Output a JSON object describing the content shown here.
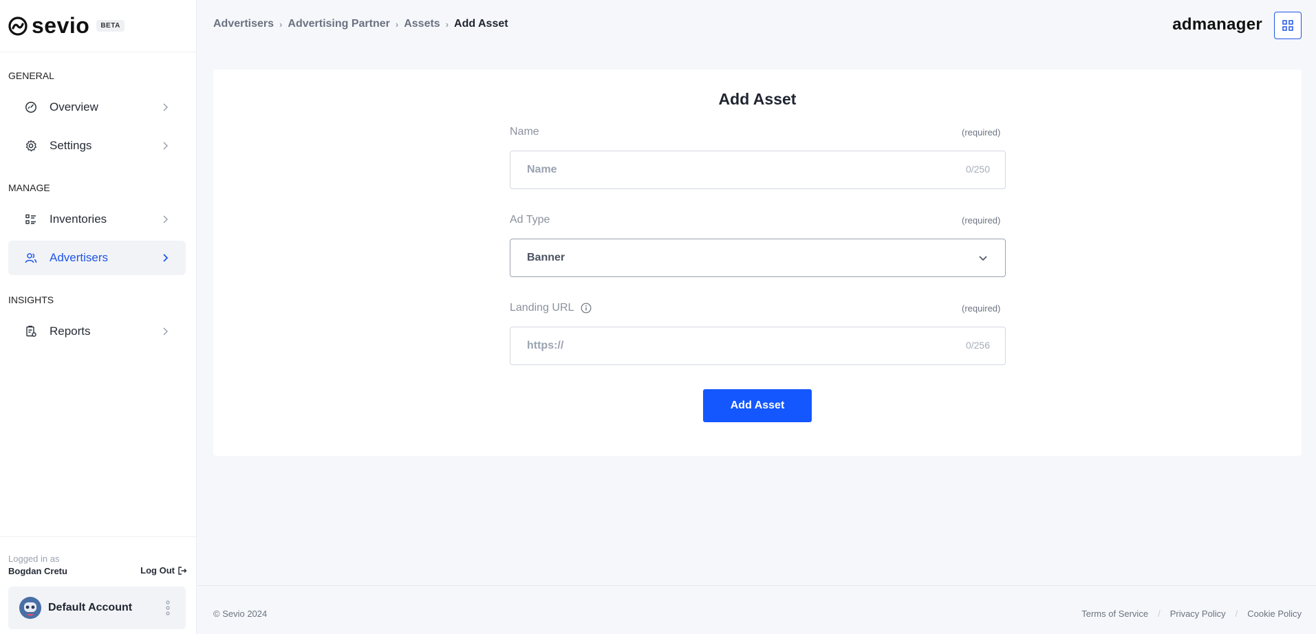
{
  "sidebar": {
    "logo_text": "sevio",
    "beta_badge": "BETA",
    "sections": {
      "general": "GENERAL",
      "manage": "MANAGE",
      "insights": "INSIGHTS"
    },
    "items": [
      {
        "label": "Overview",
        "icon": "dashboard-icon"
      },
      {
        "label": "Settings",
        "icon": "gear-icon"
      },
      {
        "label": "Inventories",
        "icon": "list-icon"
      },
      {
        "label": "Advertisers",
        "icon": "users-icon",
        "active": true
      },
      {
        "label": "Reports",
        "icon": "report-icon"
      }
    ],
    "logged_in_label": "Logged in as",
    "user_name": "Bogdan Cretu",
    "logout_label": "Log Out",
    "account_name": "Default Account"
  },
  "header": {
    "breadcrumb": [
      "Advertisers",
      "Advertising Partner",
      "Assets",
      "Add Asset"
    ],
    "brand": "admanager"
  },
  "form": {
    "title": "Add Asset",
    "name": {
      "label": "Name",
      "required": "(required)",
      "placeholder": "Name",
      "counter": "0/250"
    },
    "ad_type": {
      "label": "Ad Type",
      "required": "(required)",
      "value": "Banner"
    },
    "landing_url": {
      "label": "Landing URL",
      "required": "(required)",
      "placeholder": "https://",
      "counter": "0/256"
    },
    "submit_label": "Add Asset"
  },
  "footer": {
    "copyright": "© Sevio 2024",
    "links": [
      "Terms of Service",
      "Privacy Policy",
      "Cookie Policy"
    ]
  },
  "colors": {
    "accent": "#1457ff",
    "active_nav": "#1f55e6",
    "background": "#f5f7fa"
  }
}
